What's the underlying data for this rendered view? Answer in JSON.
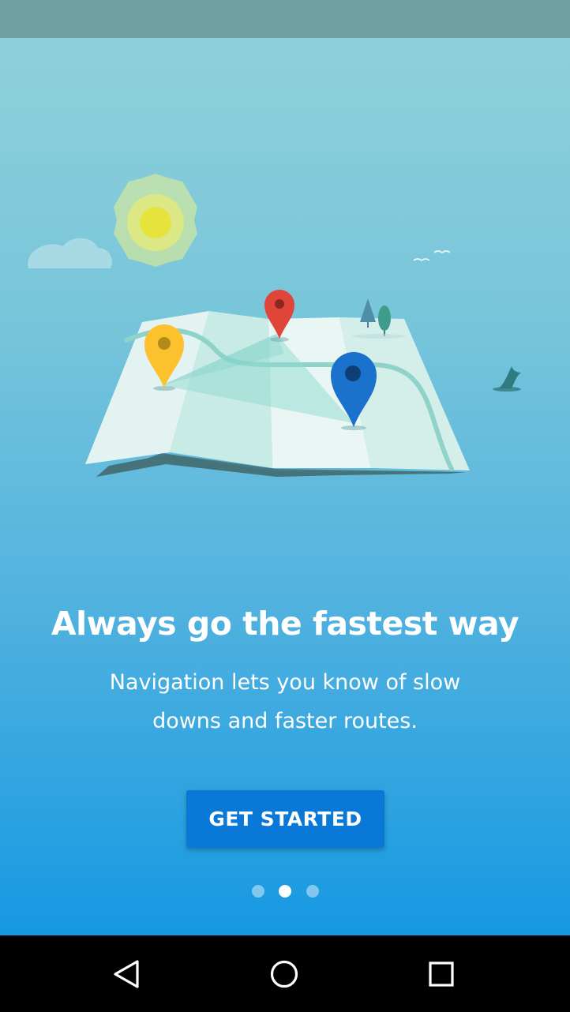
{
  "onboarding": {
    "headline": "Always go the fastest way",
    "subtext": "Navigation lets you know of slow downs and faster routes.",
    "cta_label": "GET STARTED",
    "page_indicator": {
      "total": 3,
      "current": 2
    }
  },
  "illustration": {
    "icons": [
      "sun-icon",
      "cloud-icon",
      "birds-icon",
      "folded-map",
      "yellow-pin-icon",
      "red-pin-icon",
      "blue-pin-icon",
      "trees-icon",
      "whale-tail-icon"
    ],
    "pin_colors": {
      "yellow": "#fbc22d",
      "red": "#e0453a",
      "blue": "#1a72cc"
    }
  },
  "navigation": {
    "back_icon": "back-triangle-icon",
    "home_icon": "home-circle-icon",
    "recents_icon": "recents-square-icon"
  },
  "colors": {
    "status_bar": "#6fa0a3",
    "cta_background": "#0a78d6",
    "nav_bar": "#000000"
  }
}
